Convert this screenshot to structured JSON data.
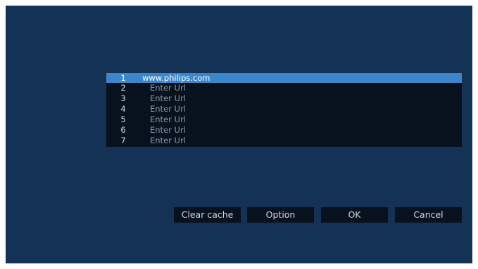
{
  "url_list": {
    "items": [
      {
        "number": "1",
        "text": "www.philips.com",
        "selected": true
      },
      {
        "number": "2",
        "text": "Enter Url",
        "selected": false
      },
      {
        "number": "3",
        "text": "Enter Url",
        "selected": false
      },
      {
        "number": "4",
        "text": "Enter Url",
        "selected": false
      },
      {
        "number": "5",
        "text": "Enter Url",
        "selected": false
      },
      {
        "number": "6",
        "text": "Enter Url",
        "selected": false
      },
      {
        "number": "7",
        "text": "Enter Url",
        "selected": false
      }
    ]
  },
  "buttons": {
    "clear_cache": "Clear cache",
    "option": "Option",
    "ok": "OK",
    "cancel": "Cancel"
  },
  "colors": {
    "background": "#133256",
    "list_background": "#08111e",
    "selection_highlight": "#3c86c9"
  }
}
